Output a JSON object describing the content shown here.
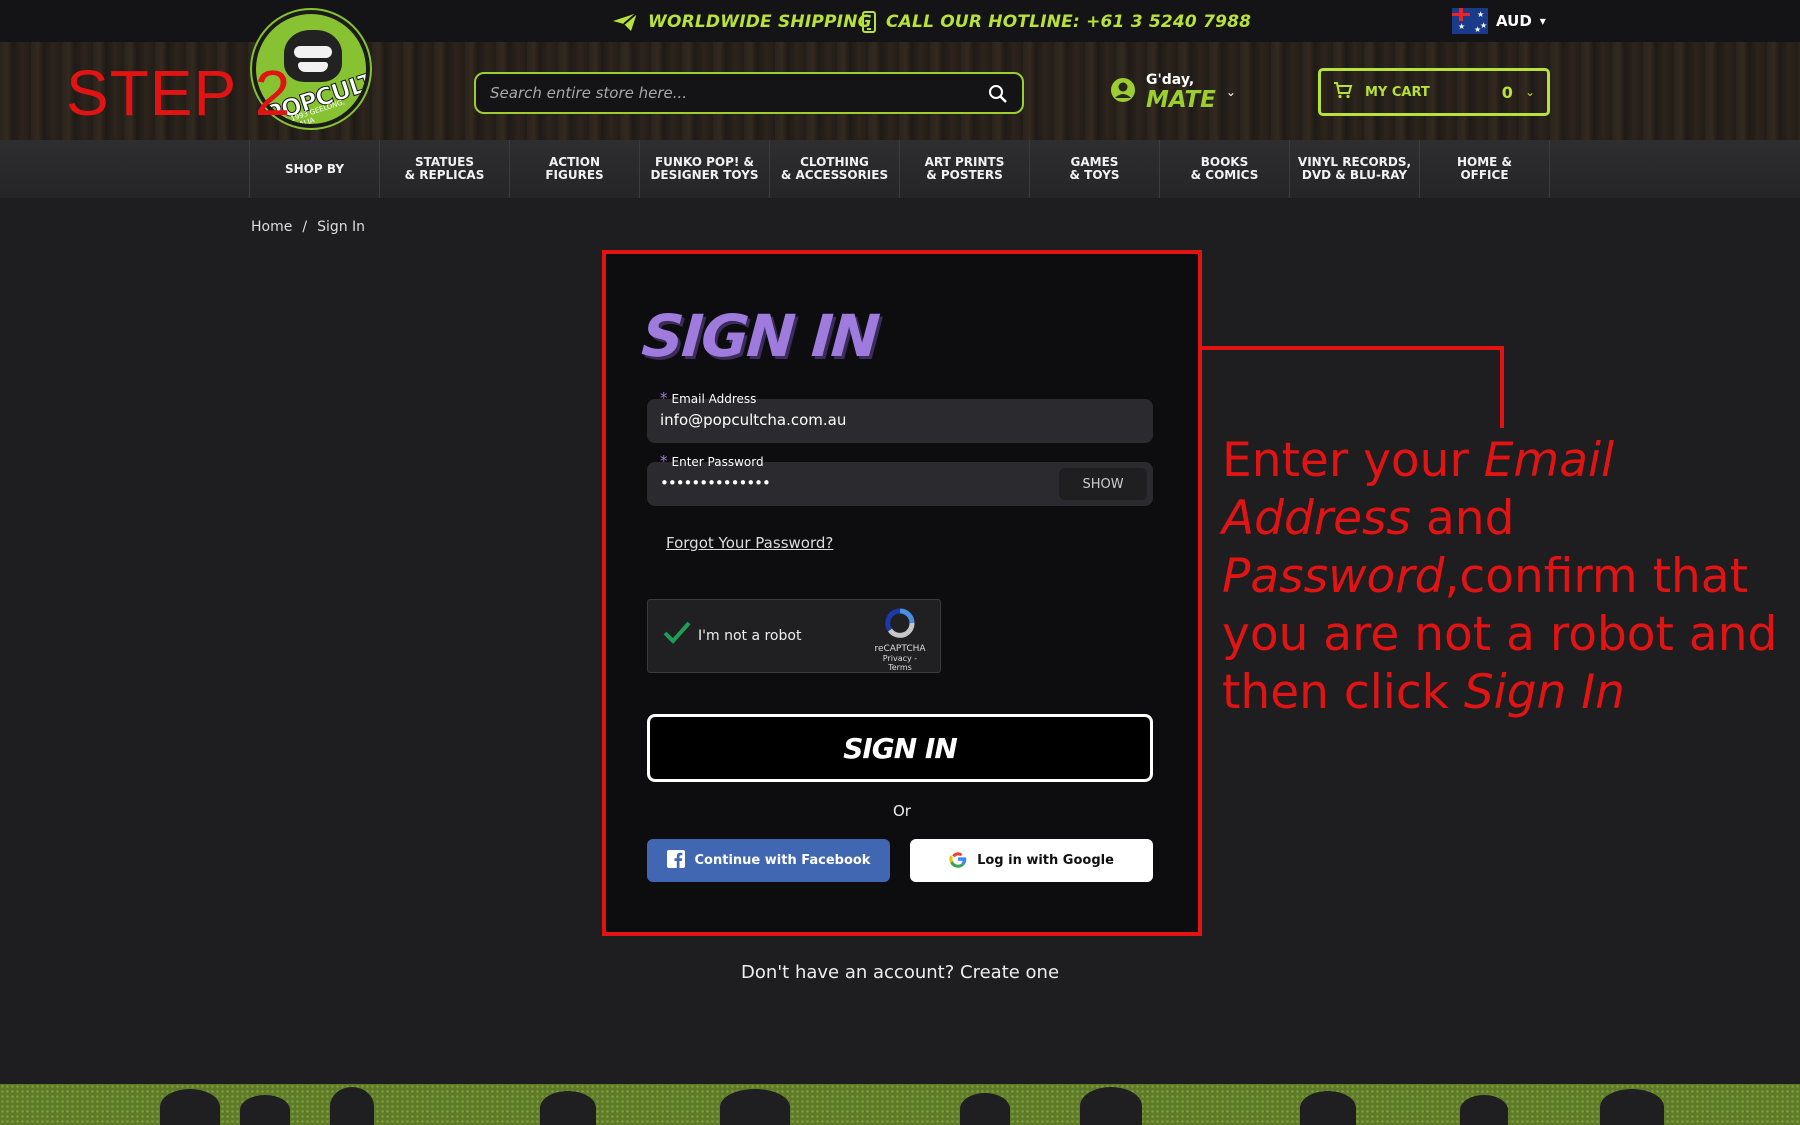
{
  "top_bar": {
    "shipping": "WORLDWIDE SHIPPING",
    "hotline": "CALL OUR HOTLINE: +61 3 5240 7988",
    "currency": "AUD"
  },
  "header": {
    "logo_text": "POPCULTCHA",
    "logo_sub": "EST. 1993 GEELONG, AUSTRALIA",
    "search_placeholder": "Search entire store here...",
    "greeting": "G'day,",
    "user_name": "MATE",
    "cart_label": "MY CART",
    "cart_count": "0"
  },
  "nav": [
    {
      "label": "SHOP BY"
    },
    {
      "label": "STATUES\n& REPLICAS"
    },
    {
      "label": "ACTION\nFIGURES"
    },
    {
      "label": "FUNKO POP! &\nDESIGNER TOYS"
    },
    {
      "label": "CLOTHING\n& ACCESSORIES"
    },
    {
      "label": "ART PRINTS\n& POSTERS"
    },
    {
      "label": "GAMES\n& TOYS"
    },
    {
      "label": "BOOKS\n& COMICS"
    },
    {
      "label": "VINYL RECORDS,\nDVD & BLU-RAY"
    },
    {
      "label": "HOME &\nOFFICE"
    }
  ],
  "step_label": "STEP 2",
  "breadcrumb": {
    "home": "Home",
    "separator": "/",
    "current": "Sign In"
  },
  "form": {
    "title": "SIGN IN",
    "email_label": "Email Address",
    "email_value": "info@popcultcha.com.au",
    "password_label": "Enter Password",
    "password_value": "••••••••••••••",
    "show_label": "SHOW",
    "required_mark": "*",
    "forgot": "Forgot Your Password?",
    "captcha_label": "I'm not a robot",
    "captcha_brand": "reCAPTCHA",
    "captcha_links": "Privacy - Terms",
    "signin_button": "SIGN IN",
    "or": "Or",
    "facebook_button": "Continue with Facebook",
    "google_button": "Log in with Google"
  },
  "footer_prompt": {
    "text": "Don't have an account?",
    "link": "Create one"
  },
  "annotation": {
    "p1": "Enter your ",
    "p2": "Email Address",
    "p3": " and ",
    "p4": "Password",
    "p5": ",confirm that you are not a robot and then click ",
    "p6": "Sign In"
  },
  "colors": {
    "accent_green": "#b6e23a",
    "accent_purple": "#9e7bdc",
    "annotation_red": "#e21313",
    "facebook_blue": "#4267b2"
  }
}
